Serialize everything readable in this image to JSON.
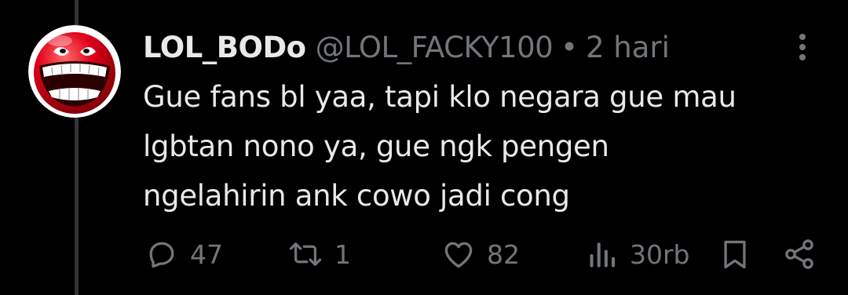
{
  "tweet": {
    "display_name": "LOL_BODo",
    "handle": "@LOL_FACKY100",
    "separator": "•",
    "time": "2 hari",
    "text_lines": [
      "Gue fans bl yaa, tapi klo negara gue mau",
      "lgbtan nono ya, gue ngk pengen",
      "ngelahirin ank cowo jadi cong"
    ]
  },
  "actions": {
    "reply_count": "47",
    "retweet_count": "1",
    "like_count": "82",
    "view_count": "30rb"
  },
  "icons": {
    "avatar": "red-laughing-face-icon",
    "more": "more-vertical-icon",
    "reply": "reply-icon",
    "retweet": "retweet-icon",
    "like": "heart-icon",
    "views": "views-chart-icon",
    "bookmark": "bookmark-icon",
    "share": "share-icon"
  },
  "colors": {
    "background": "#000000",
    "text_primary": "#e7e9ea",
    "text_secondary": "#71767b",
    "thread_line": "#333639",
    "avatar_red": "#e2001a"
  }
}
